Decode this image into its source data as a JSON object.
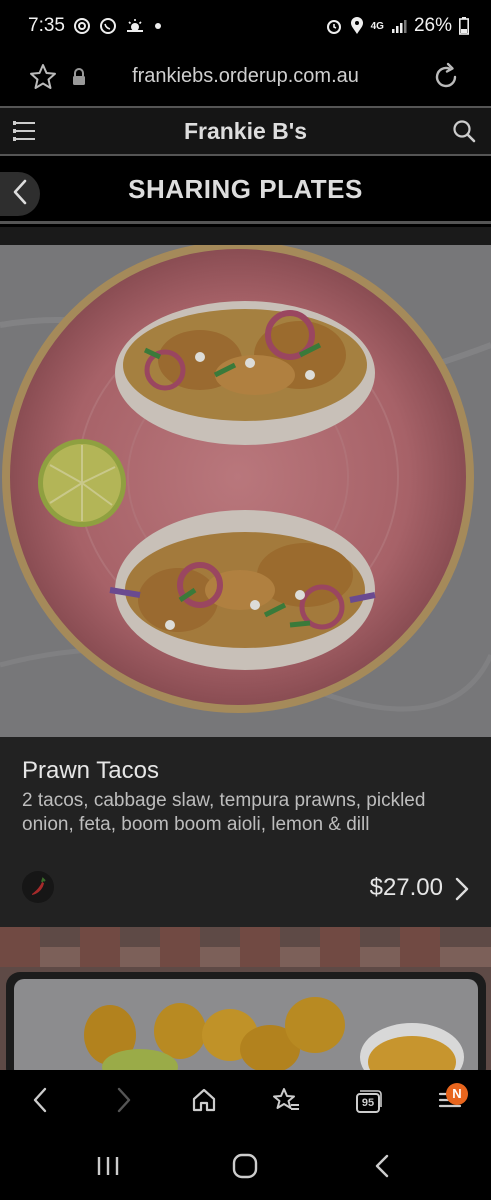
{
  "status_bar": {
    "time": "7:35",
    "battery": "26%",
    "network": "4G"
  },
  "browser": {
    "url": "frankiebs.orderup.com.au"
  },
  "site": {
    "brand": "Frankie B's"
  },
  "category": {
    "title": "SHARING PLATES"
  },
  "item": {
    "name": "Prawn Tacos",
    "description": "2 tacos, cabbage slaw, tempura prawns, pickled onion, feta, boom boom aioli, lemon & dill",
    "price": "$27.00",
    "dietary_icon": "chili-icon"
  },
  "browser_nav": {
    "tabs_count": "95",
    "menu_badge": "N",
    "badge_color": "#e8651d"
  }
}
